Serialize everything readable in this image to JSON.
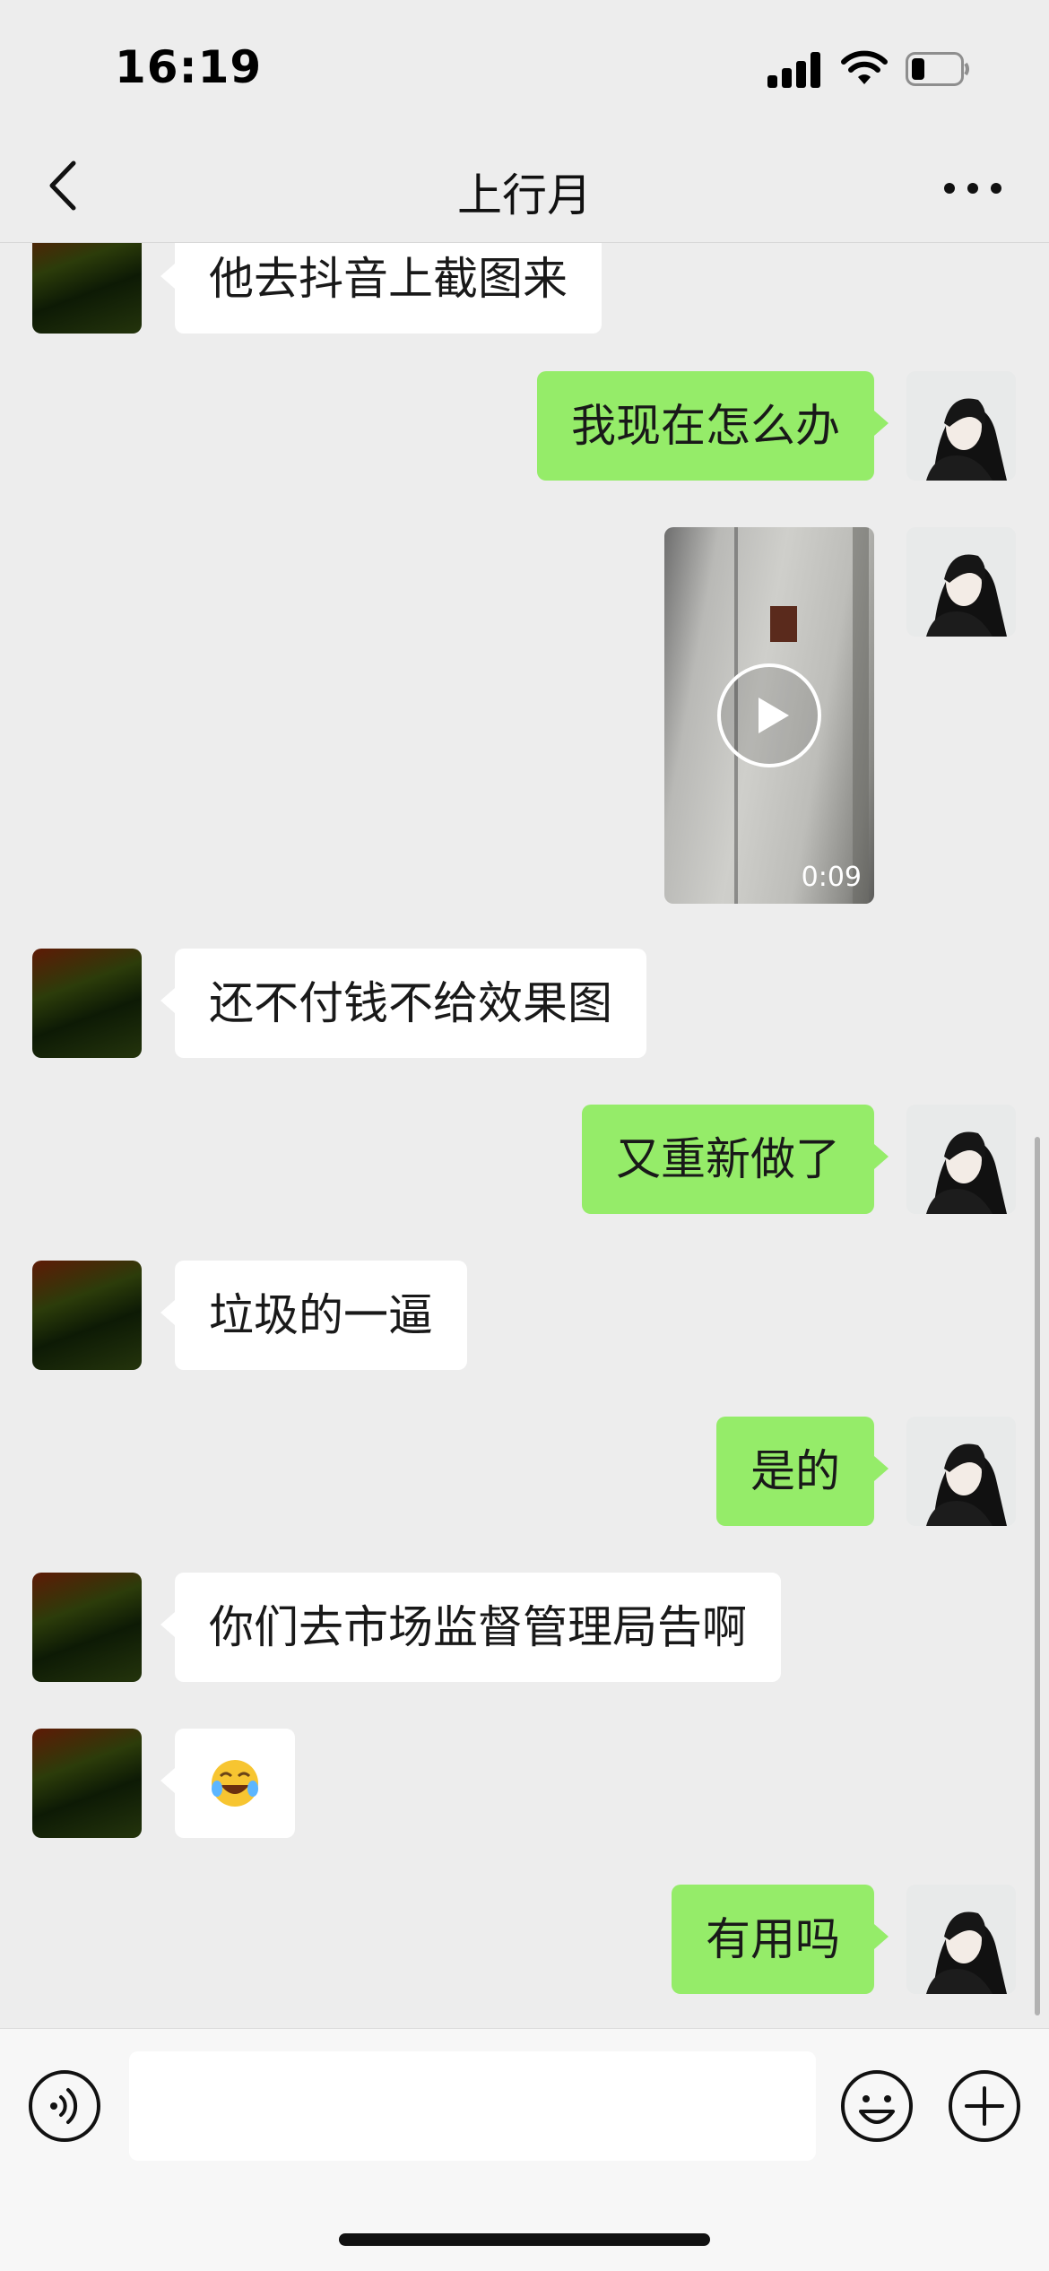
{
  "status_bar": {
    "time": "16:19"
  },
  "header": {
    "title": "上行月"
  },
  "messages": [
    {
      "sender": "other",
      "text": "他去抖音上截图来"
    },
    {
      "sender": "me",
      "text": "我现在怎么办"
    },
    {
      "sender": "me",
      "type": "video",
      "duration": "0:09"
    },
    {
      "sender": "other",
      "text": "还不付钱不给效果图"
    },
    {
      "sender": "me",
      "text": "又重新做了"
    },
    {
      "sender": "other",
      "text": "垃圾的一逼"
    },
    {
      "sender": "me",
      "text": "是的"
    },
    {
      "sender": "other",
      "text": "你们去市场监督管理局告啊"
    },
    {
      "sender": "other",
      "type": "emoji",
      "icon": "crying-laughing-emoji-icon"
    },
    {
      "sender": "me",
      "text": "有用吗"
    }
  ],
  "input_bar": {
    "value": "",
    "icons": [
      "voice-icon",
      "emoji-icon",
      "plus-icon"
    ]
  },
  "colors": {
    "my_bubble": "#95ec69",
    "their_bubble": "#ffffff",
    "background": "#ededed"
  }
}
